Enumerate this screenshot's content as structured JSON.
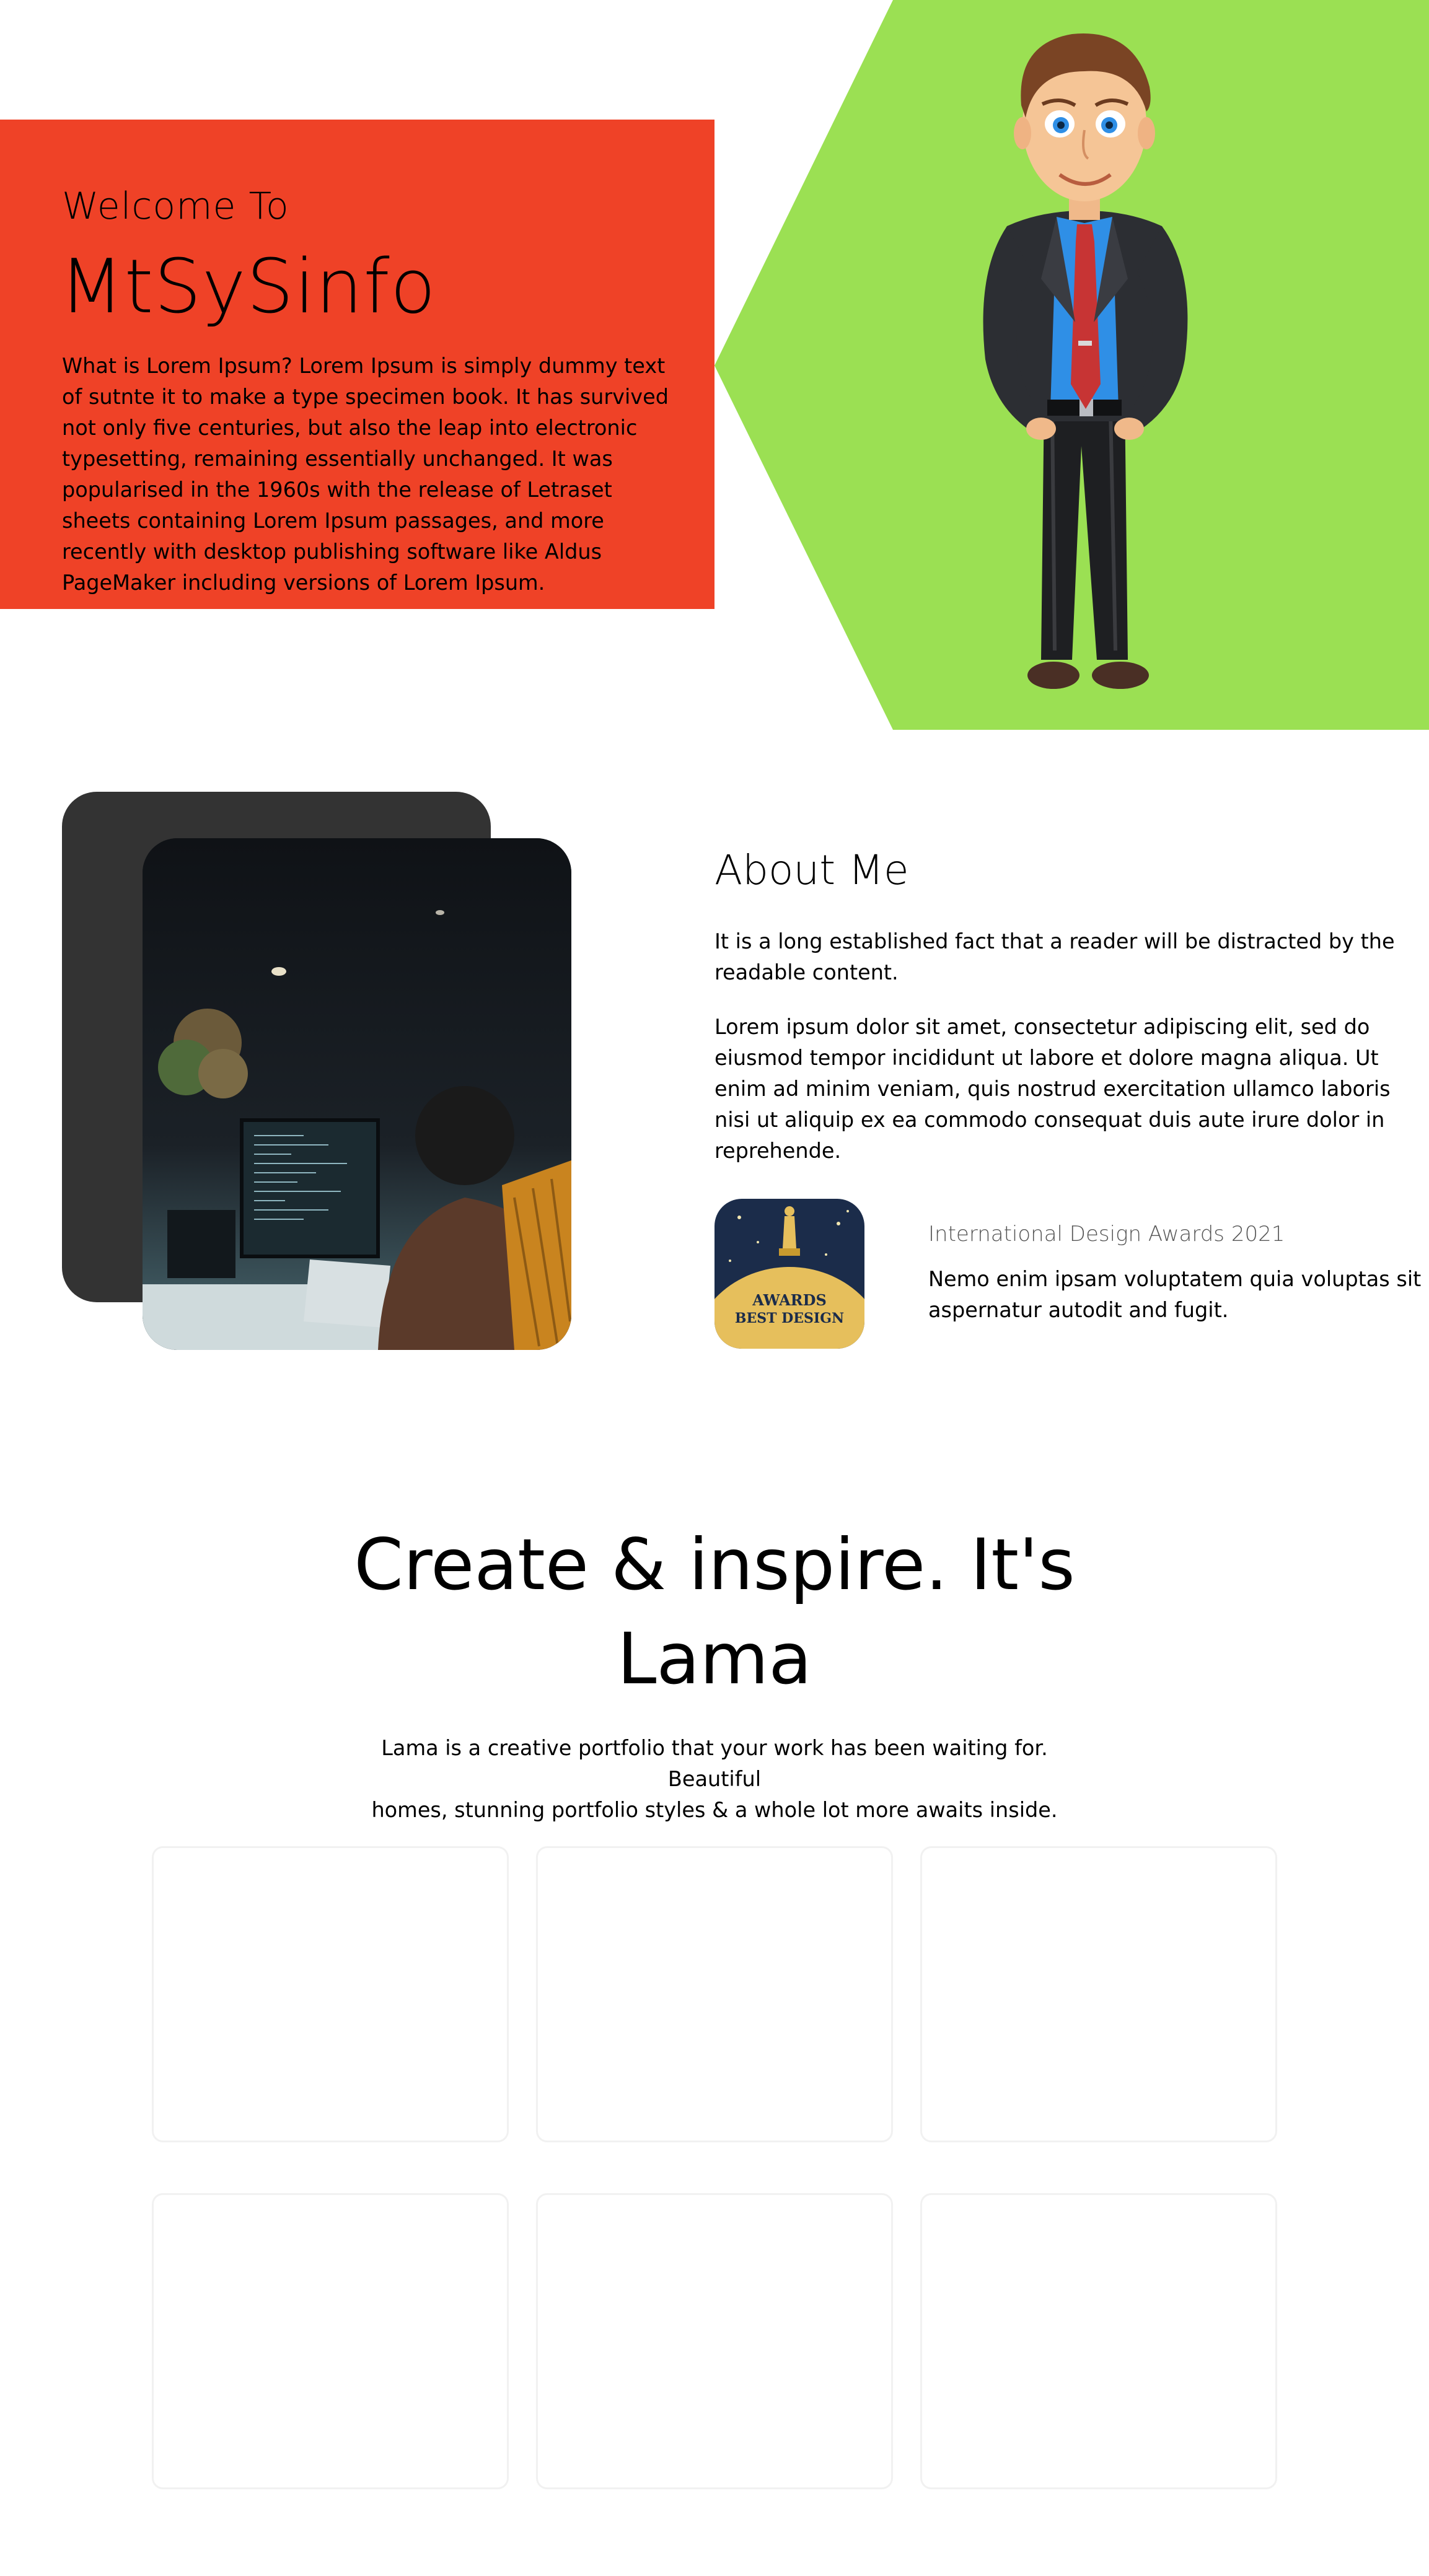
{
  "hero": {
    "welcome": "Welcome To",
    "title": "MtSySinfo",
    "description": "What is Lorem Ipsum? Lorem Ipsum is simply dummy text of sutnte it to make a type specimen book. It has survived not only five centuries, but also the leap into electronic typesetting, remaining essentially unchanged. It was popularised in the 1960s with the release of Letraset sheets containing Lorem Ipsum passages, and more recently with desktop publishing software like Aldus PageMaker including versions of Lorem Ipsum.",
    "colors": {
      "red": "#ef4227",
      "green": "#9be053"
    },
    "illustration": "businessman-cartoon"
  },
  "about": {
    "title": "About Me",
    "paragraph1": "It is a long established fact that a reader will be distracted by the readable content.",
    "paragraph2": "Lorem ipsum dolor sit amet, consectetur adipiscing elit, sed do eiusmod tempor incididunt ut labore et dolore magna aliqua. Ut enim ad minim veniam, quis nostrud exercitation ullamco laboris nisi ut aliquip ex ea commodo consequat duis aute irure dolor in reprehende.",
    "photo": "developer-working-at-computer-photo",
    "award": {
      "icon": "award-trophy-icon",
      "badge_line1": "AWARDS",
      "badge_line2": "BEST DESIGN",
      "title": "International Design Awards 2021",
      "description": "Nemo enim ipsam voluptatem quia voluptas sit aspernatur autodit and fugit."
    }
  },
  "inspire": {
    "title_line1": "Create & inspire. It's",
    "title_line2": "Lama",
    "description_line1": "Lama is a creative portfolio that your work has been waiting for. Beautiful",
    "description_line2": "homes, stunning portfolio styles & a whole lot more awaits inside.",
    "cards": [
      "",
      "",
      "",
      "",
      "",
      ""
    ]
  }
}
